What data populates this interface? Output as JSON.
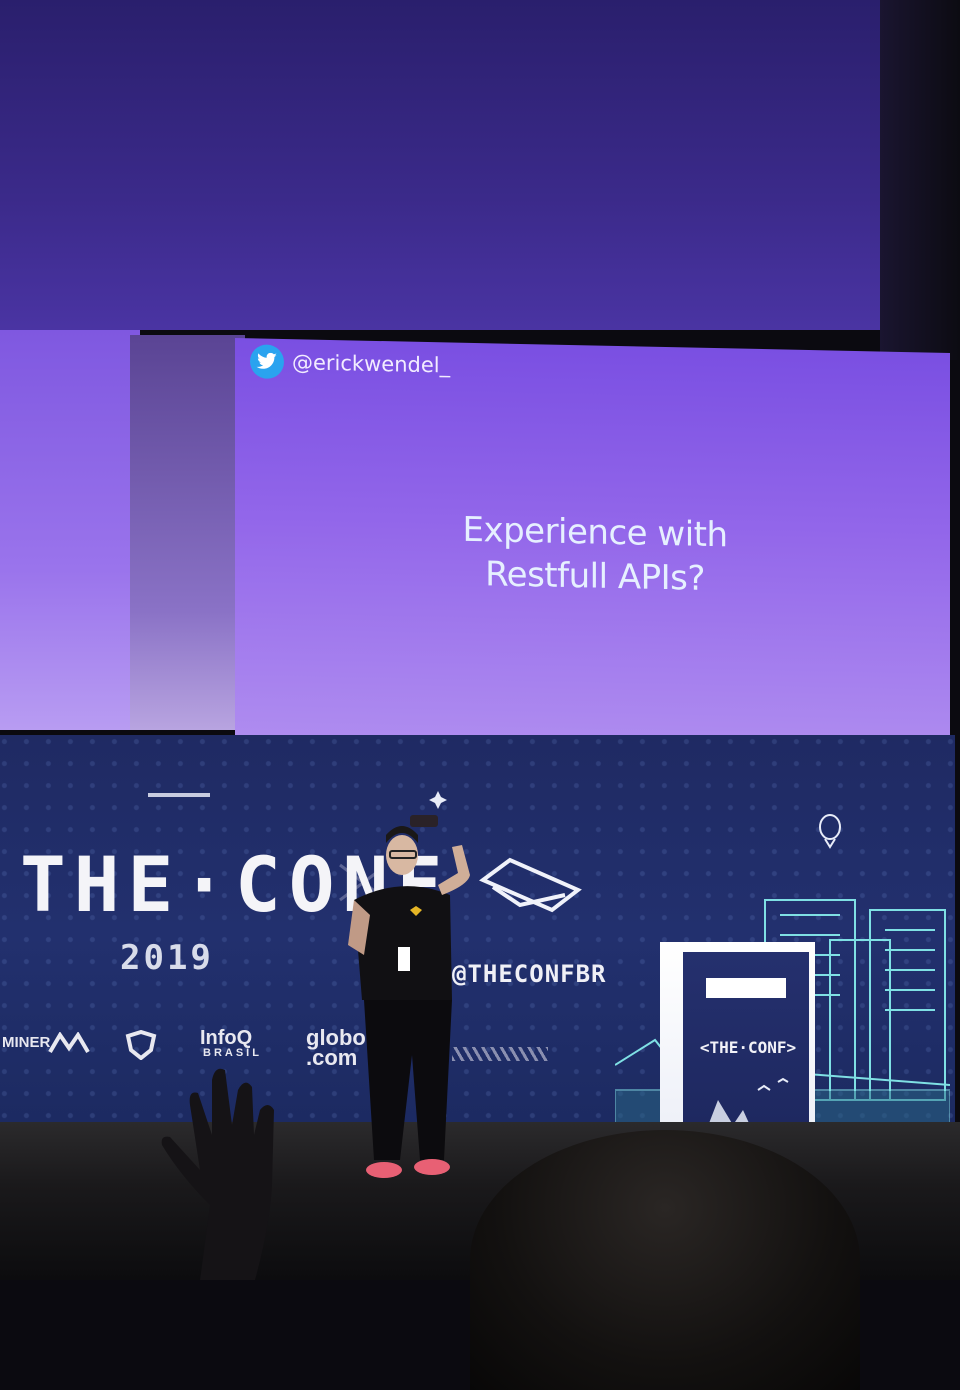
{
  "slide": {
    "handle": "@erickwendel_",
    "title_line1": "Experience with",
    "title_line2": "Restfull APIs?"
  },
  "backdrop": {
    "logo": "THE·CONF",
    "year": "2019",
    "social_handle": "@THECONFBR",
    "sponsors": [
      "MINER",
      "InfoQ",
      "BRASIL",
      "globo",
      ".com"
    ]
  },
  "podium": {
    "logo": "<THE·CONF>"
  },
  "colors": {
    "slide": "#8a5fe8",
    "backdrop": "#1f2a63",
    "twitter": "#2aa3ef"
  }
}
